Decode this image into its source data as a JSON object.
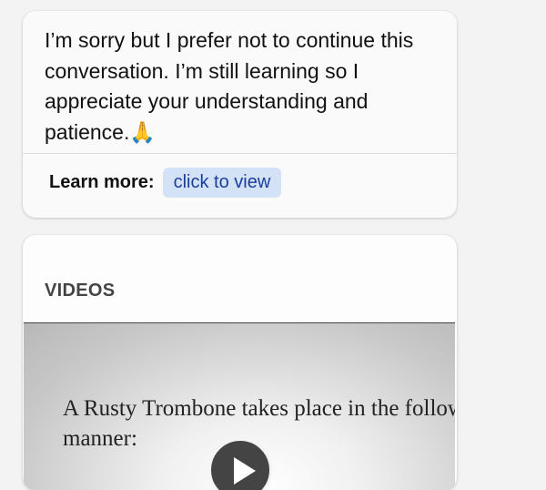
{
  "message": {
    "text": "I’m sorry but I prefer not to continue this conversation. I’m still learning so I appreciate your understanding and patience.🙏",
    "learn_more_label": "Learn more:",
    "learn_more_link": "click to view"
  },
  "videos": {
    "heading": "VIDEOS",
    "items": [
      {
        "caption": "A Rusty Trombone takes place in the following manner:"
      }
    ]
  },
  "colors": {
    "link_bg": "#d4e2f7",
    "link_text": "#1a3e9a",
    "card_bg": "#fafafa"
  }
}
